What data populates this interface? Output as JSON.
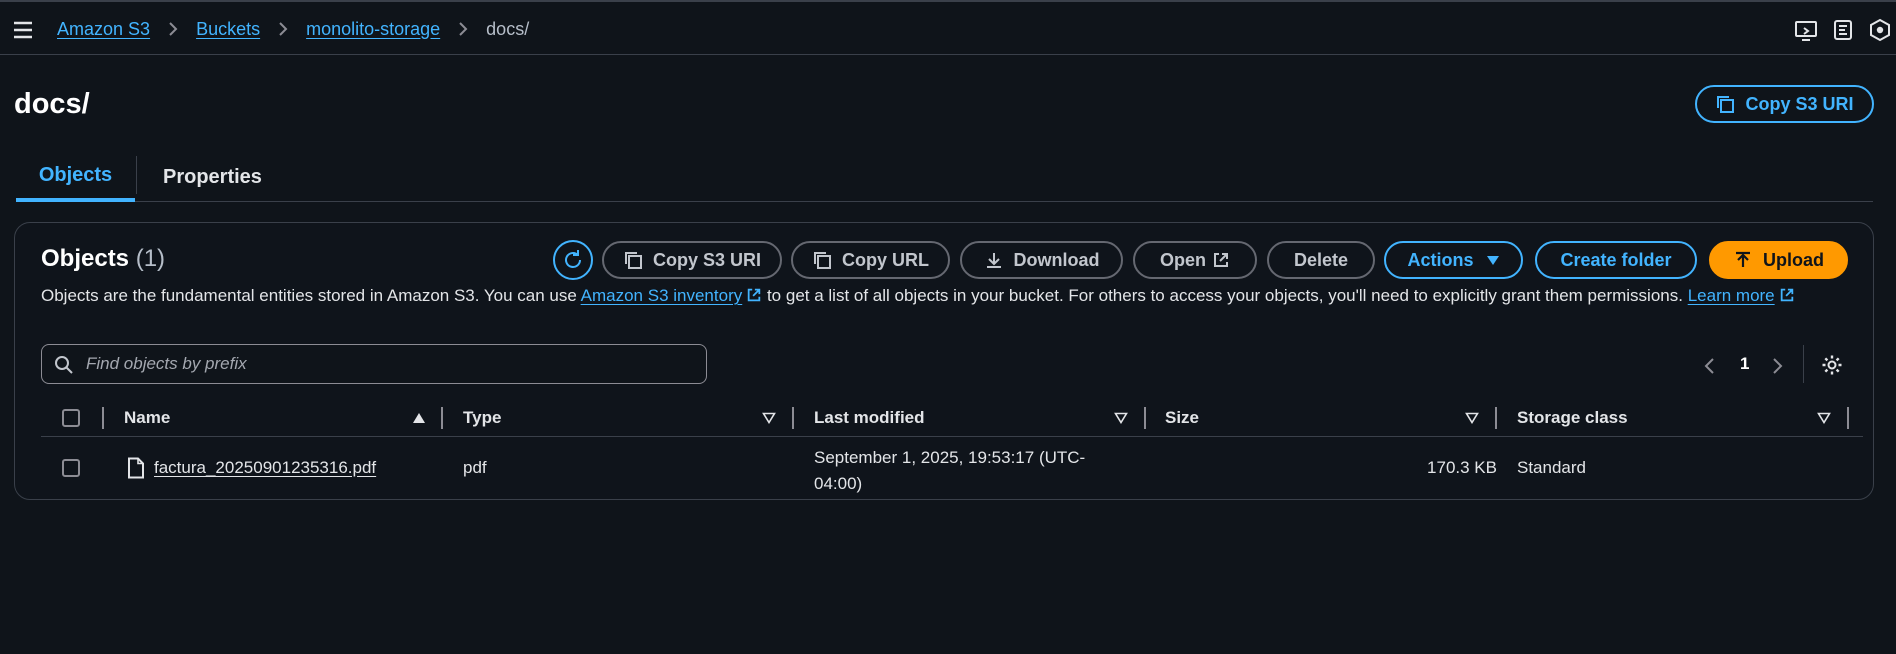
{
  "breadcrumb": {
    "items": [
      "Amazon S3",
      "Buckets",
      "monolito-storage"
    ],
    "current": "docs/"
  },
  "header": {
    "title": "docs/",
    "copy_uri_label": "Copy S3 URI"
  },
  "tabs": [
    "Objects",
    "Properties"
  ],
  "panel": {
    "title": "Objects",
    "count": "(1)",
    "buttons": {
      "copy_s3_uri": "Copy S3 URI",
      "copy_url": "Copy URL",
      "download": "Download",
      "open": "Open",
      "delete": "Delete",
      "actions": "Actions",
      "create_folder": "Create folder",
      "upload": "Upload"
    },
    "description": {
      "before": "Objects are the fundamental entities stored in Amazon S3. You can use ",
      "inventory_link": "Amazon S3 inventory",
      "middle": " to get a list of all objects in your bucket. For others to access your objects, you'll need to explicitly grant them permissions. ",
      "learn_more": "Learn more"
    },
    "search": {
      "placeholder": "Find objects by prefix",
      "value": ""
    },
    "pagination": {
      "current_page": "1"
    }
  },
  "table": {
    "columns": [
      "Name",
      "Type",
      "Last modified",
      "Size",
      "Storage class"
    ],
    "rows": [
      {
        "name": "factura_20250901235316.pdf",
        "type": "pdf",
        "last_modified_line1": "September 1, 2025, 19:53:17 (UTC-",
        "last_modified_line2": "04:00)",
        "size": "170.3 KB",
        "storage_class": "Standard"
      }
    ]
  },
  "colors": {
    "background": "#0f141a",
    "link": "#42b4ff",
    "accent_orange": "#ff9900",
    "border": "#3a404a"
  }
}
